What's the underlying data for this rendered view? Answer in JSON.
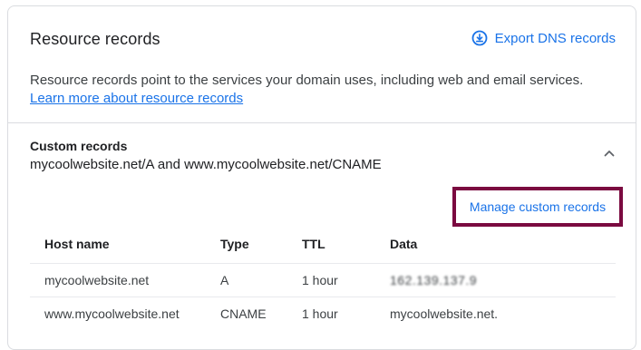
{
  "card": {
    "title": "Resource records",
    "export_label": "Export DNS records",
    "export_icon": "download-circle-icon",
    "description_text": "Resource records point to the services your domain uses, including web and email services. ",
    "learn_more_label": "Learn more about resource records"
  },
  "custom_records": {
    "title": "Custom records",
    "subtitle": "mycoolwebsite.net/A and www.mycoolwebsite.net/CNAME",
    "collapse_icon": "chevron-up-icon",
    "manage_label": "Manage custom records",
    "table": {
      "headers": {
        "host": "Host name",
        "type": "Type",
        "ttl": "TTL",
        "data": "Data"
      },
      "rows": [
        {
          "host": "mycoolwebsite.net",
          "type": "A",
          "ttl": "1 hour",
          "data": "162.139.137.9"
        },
        {
          "host": "www.mycoolwebsite.net",
          "type": "CNAME",
          "ttl": "1 hour",
          "data": "mycoolwebsite.net."
        }
      ]
    }
  },
  "colors": {
    "link": "#1a73e8",
    "highlight_border": "#7b0a40",
    "divider": "#dadce0",
    "text": "#202124"
  }
}
